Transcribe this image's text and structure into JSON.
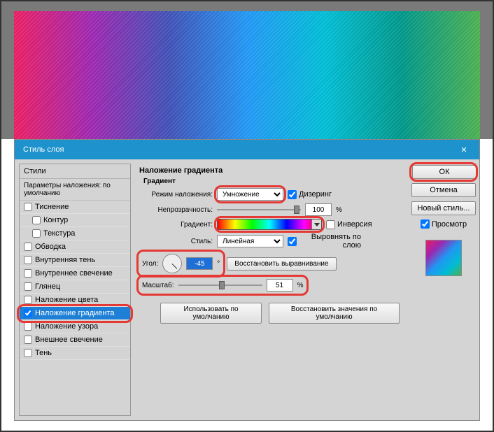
{
  "dialog": {
    "title": "Стиль слоя",
    "close_icon": "✕"
  },
  "sidebar": {
    "header": "Стили",
    "subheader": "Параметры наложения: по умолчанию",
    "items": [
      {
        "label": "Тиснение",
        "checked": false,
        "selected": false
      },
      {
        "label": "Контур",
        "checked": false,
        "selected": false
      },
      {
        "label": "Текстура",
        "checked": false,
        "selected": false
      },
      {
        "label": "Обводка",
        "checked": false,
        "selected": false
      },
      {
        "label": "Внутренняя тень",
        "checked": false,
        "selected": false
      },
      {
        "label": "Внутреннее свечение",
        "checked": false,
        "selected": false
      },
      {
        "label": "Глянец",
        "checked": false,
        "selected": false
      },
      {
        "label": "Наложение цвета",
        "checked": false,
        "selected": false
      },
      {
        "label": "Наложение градиента",
        "checked": true,
        "selected": true
      },
      {
        "label": "Наложение узора",
        "checked": false,
        "selected": false
      },
      {
        "label": "Внешнее свечение",
        "checked": false,
        "selected": false
      },
      {
        "label": "Тень",
        "checked": false,
        "selected": false
      }
    ]
  },
  "panel": {
    "title": "Наложение градиента",
    "group": "Градиент",
    "blend_label": "Режим наложения:",
    "blend_value": "Умножение",
    "dither_label": "Дизеринг",
    "dither_checked": true,
    "opacity_label": "Непрозрачность:",
    "opacity_value": "100",
    "opacity_unit": "%",
    "gradient_label": "Градиент:",
    "invert_label": "Инверсия",
    "invert_checked": false,
    "style_label": "Стиль:",
    "style_value": "Линейная",
    "align_label": "Выровнять по слою",
    "align_checked": true,
    "angle_label": "Угол:",
    "angle_value": "-45",
    "angle_unit": "°",
    "reset_align": "Восстановить выравнивание",
    "scale_label": "Масштаб:",
    "scale_value": "51",
    "scale_unit": "%",
    "make_default": "Использовать по умолчанию",
    "reset_default": "Восстановить значения по умолчанию"
  },
  "right": {
    "ok": "ОК",
    "cancel": "Отмена",
    "new_style": "Новый стиль...",
    "preview_label": "Просмотр",
    "preview_checked": true
  }
}
